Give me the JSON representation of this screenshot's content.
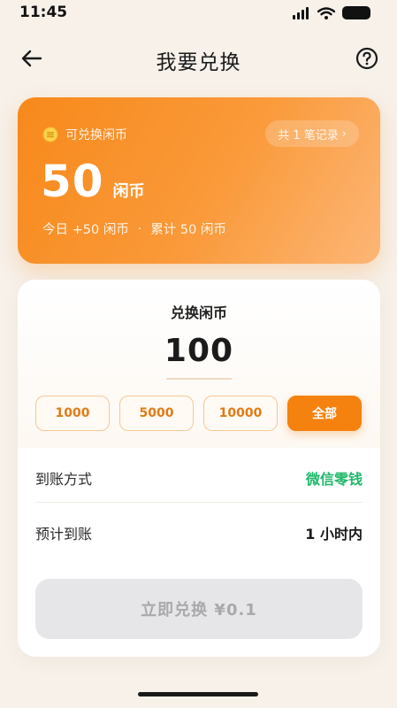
{
  "status_bar": {
    "time": "11:45"
  },
  "nav": {
    "title": "我要兑换"
  },
  "balance_card": {
    "label": "可兑换闲币",
    "record_pill": "共 1 笔记录",
    "record_chevron": "›",
    "balance": "50",
    "unit": "闲币",
    "today": "今日 +50 闲币",
    "separator": "·",
    "total": "累计 50 闲币"
  },
  "exchange": {
    "title": "兑换闲币",
    "amount": "100",
    "presets": [
      "1000",
      "5000",
      "10000",
      "全部"
    ],
    "active_preset_index": 3
  },
  "details": {
    "method_label": "到账方式",
    "method_value": "微信零钱",
    "eta_label": "预计到账",
    "eta_value": "1 小时内"
  },
  "submit": {
    "label": "立即兑换 ¥0.1"
  },
  "colors": {
    "accent": "#f5820f",
    "success": "#1fb86a",
    "disabled_bg": "#e6e6e8",
    "disabled_text": "#a9a9ad"
  }
}
